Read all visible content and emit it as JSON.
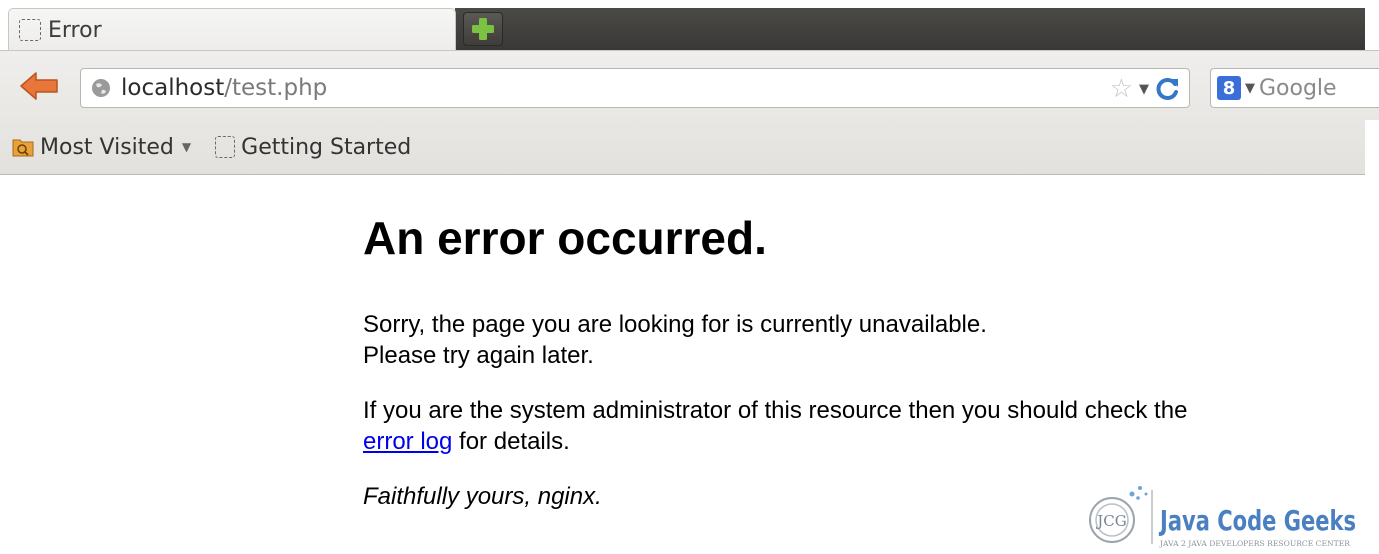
{
  "tab": {
    "title": "Error",
    "new_tab_icon": "plus-icon"
  },
  "navbar": {
    "back_icon": "back-arrow-icon",
    "url_host": "localhost",
    "url_path": "/test.php",
    "bookmark_star_icon": "star-icon",
    "reload_icon": "reload-icon",
    "search_engine_icon": "google-icon",
    "search_engine_glyph": "8",
    "search_placeholder": "Google"
  },
  "bookmarks": {
    "most_visited": "Most Visited",
    "getting_started": "Getting Started"
  },
  "page": {
    "title": "An error occurred.",
    "line1": "Sorry, the page you are looking for is currently unavailable.",
    "line2": "Please try again later.",
    "line3": "If you are the system administrator of this resource then you should check the",
    "link": "error log",
    "line4": " for details.",
    "signature": "Faithfully yours, nginx."
  },
  "watermark": {
    "brand": "Java Code Geeks",
    "tagline": "JAVA 2 JAVA DEVELOPERS RESOURCE CENTER",
    "logo_text": "JCG"
  },
  "colors": {
    "link": "#0000ee",
    "accent_green": "#7cc242",
    "back_arrow": "#e8763a"
  }
}
